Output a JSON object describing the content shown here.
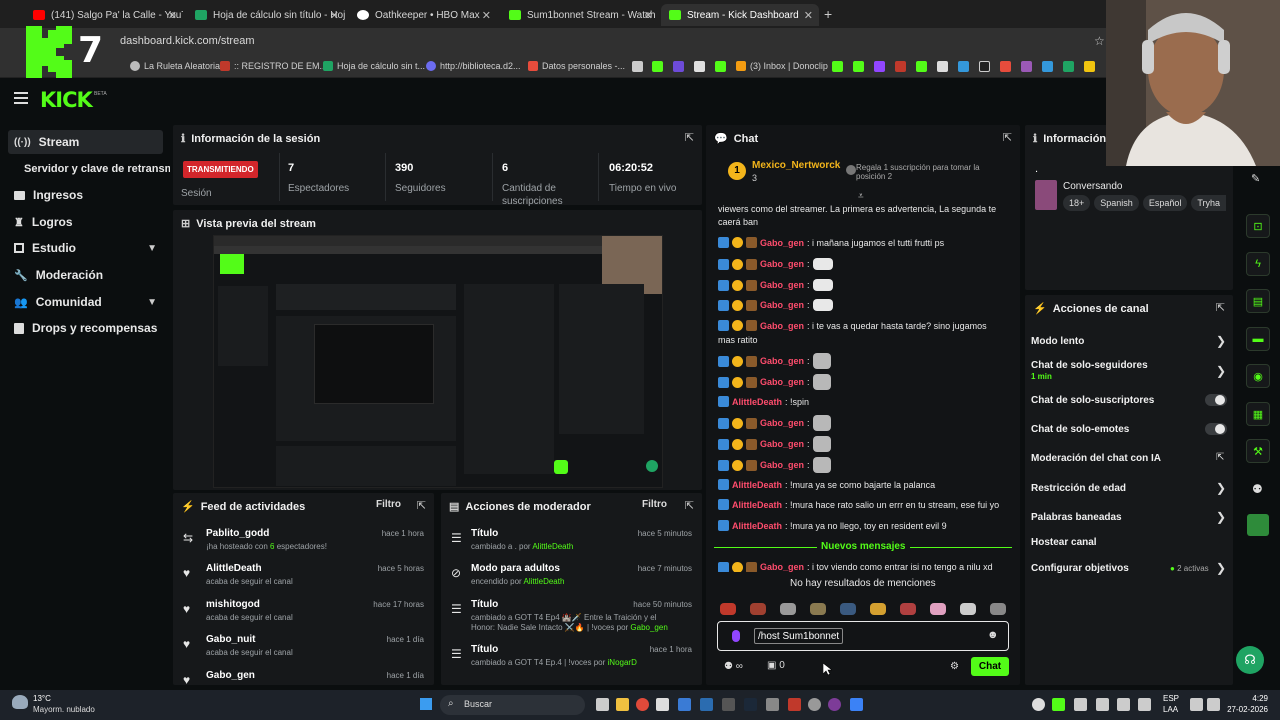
{
  "browser": {
    "tabs": [
      {
        "label": "(141) Salgo Pa' la Calle - YouTu",
        "color": "#ff0000"
      },
      {
        "label": "Hoja de cálculo sin título - Hoja",
        "color": "#1fa463"
      },
      {
        "label": "Oathkeeper • HBO Max",
        "color": "#ffffff"
      },
      {
        "label": "Sum1bonnet Stream - Watch Li",
        "color": "#53fc18"
      },
      {
        "label": "Stream - Kick Dashboard",
        "color": "#53fc18"
      }
    ],
    "new_tab": "+",
    "url": "dashboard.kick.com/stream",
    "bookmarks": [
      "La Ruleta Aleatoria",
      ":: REGISTRO DE EM...",
      "Hoja de cálculo sin t...",
      "http://biblioteca.d2...",
      "Datos personales -...",
      "(3) Inbox | Donoclip"
    ]
  },
  "logo": {
    "overlay_text": "7",
    "app_logo": "KICK",
    "beta": "BETA"
  },
  "sidebar": {
    "items": [
      {
        "label": "Stream",
        "icon": "signal-icon"
      },
      {
        "label": "Servidor y clave de retransm",
        "icon": ""
      },
      {
        "label": "Ingresos",
        "icon": "wallet-icon"
      },
      {
        "label": "Logros",
        "icon": "trophy-icon"
      },
      {
        "label": "Estudio",
        "icon": "grid-icon"
      },
      {
        "label": "Moderación",
        "icon": "wrench-icon"
      },
      {
        "label": "Comunidad",
        "icon": "people-icon"
      },
      {
        "label": "Drops y recompensas",
        "icon": "gift-icon"
      }
    ]
  },
  "session": {
    "title": "Información de la sesión",
    "status": "TRANSMITIENDO",
    "status_label": "Sesión",
    "stats": [
      {
        "value": "7",
        "label": "Espectadores"
      },
      {
        "value": "390",
        "label": "Seguidores"
      },
      {
        "value": "6",
        "label": "Cantidad de suscripciones"
      },
      {
        "value": "06:20:52",
        "label": "Tiempo en vivo"
      }
    ]
  },
  "preview": {
    "title": "Vista previa del stream"
  },
  "feed": {
    "title": "Feed de actividades",
    "filter": "Filtro",
    "items": [
      {
        "name": "Pablito_godd",
        "sub_pre": "¡ha hosteado con ",
        "sub_hl": "6",
        "sub_post": " espectadores!",
        "time": "hace 1 hora",
        "icon": "host-icon"
      },
      {
        "name": "AlittleDeath",
        "sub_pre": "acaba de seguir el canal",
        "sub_hl": "",
        "sub_post": "",
        "time": "hace 5 horas",
        "icon": "heart-icon"
      },
      {
        "name": "mishitogod",
        "sub_pre": "acaba de seguir el canal",
        "sub_hl": "",
        "sub_post": "",
        "time": "hace 17 horas",
        "icon": "heart-icon"
      },
      {
        "name": "Gabo_nuit",
        "sub_pre": "acaba de seguir el canal",
        "sub_hl": "",
        "sub_post": "",
        "time": "hace 1 día",
        "icon": "heart-icon"
      },
      {
        "name": "Gabo_gen",
        "sub_pre": "",
        "sub_hl": "",
        "sub_post": "",
        "time": "hace 1 día",
        "icon": "heart-icon"
      }
    ]
  },
  "modactions": {
    "title": "Acciones de moderador",
    "filter": "Filtro",
    "items": [
      {
        "name": "Título",
        "sub_pre": "cambiado a . por ",
        "sub_hl": "AlittleDeath",
        "time": "hace 5 minutos",
        "icon": "list-icon"
      },
      {
        "name": "Modo para adultos",
        "sub_pre": "encendido por ",
        "sub_hl": "AlittleDeath",
        "time": "hace 7 minutos",
        "icon": "slash-icon"
      },
      {
        "name": "Título",
        "sub_pre": "cambiado a GOT T4 Ep4 🏰🗡️ Entre la Traición y el Honor: Nadie Sale Intacto ⚔️🔥 | !voces por ",
        "sub_hl": "Gabo_gen",
        "time": "hace 50 minutos",
        "icon": "list-icon"
      },
      {
        "name": "Título",
        "sub_pre": "cambiado a GOT T4 Ep.4 | !voces por ",
        "sub_hl": "iNogarD",
        "time": "hace 1 hora",
        "icon": "list-icon"
      }
    ]
  },
  "chat": {
    "title": "Chat",
    "pinned_user": "Mexico_Nertworck",
    "pinned_count": "3",
    "pinned_promo": "Regala 1 suscripción para tomar la posición 2",
    "top_text": "viewers como del streamer. La primera es advertencia, La segunda te caerá ban",
    "messages": [
      {
        "user": "Gabo_gen",
        "text": ": i mañana jugamos el tutti frutti ps",
        "emote": false
      },
      {
        "user": "Gabo_gen",
        "text": ":",
        "emote": true
      },
      {
        "user": "Gabo_gen",
        "text": ":",
        "emote": true
      },
      {
        "user": "Gabo_gen",
        "text": ":",
        "emote": true
      },
      {
        "user": "Gabo_gen",
        "text": ": i te vas a quedar hasta tarde? sino jugamos",
        "emote": false
      },
      {
        "user": "Gabo_gen",
        "text": ":",
        "emote": true
      },
      {
        "user": "Gabo_gen",
        "text": ":",
        "emote": true
      },
      {
        "user": "AlittleDeath",
        "text": ": !spin",
        "emote": false
      },
      {
        "user": "Gabo_gen",
        "text": ":",
        "emote": true
      },
      {
        "user": "Gabo_gen",
        "text": ":",
        "emote": true
      },
      {
        "user": "Gabo_gen",
        "text": ":",
        "emote": true
      },
      {
        "user": "AlittleDeath",
        "text": ": !mura ya se como bajarte la palanca",
        "emote": false
      },
      {
        "user": "AlittleDeath",
        "text": ": !mura hace rato salio un errr en tu stream, ese fui yo",
        "emote": false
      },
      {
        "user": "AlittleDeath",
        "text": ": !mura ya no llego, toy en resident evil 9",
        "emote": false
      }
    ],
    "wrap_line": "mas ratito",
    "new_messages": "Nuevos mensajes",
    "last_msg_user": "Gabo_gen",
    "last_msg_text": ": i tov viendo como entrar isi no tengo a nilu xd",
    "no_mentions": "No hay resultados de menciones",
    "input_value": "/host Sum1bonnet",
    "viewers_icon_text": "∞",
    "points": "0",
    "send": "Chat"
  },
  "channel_info": {
    "title": "Información d",
    "dot": ".",
    "category": "Conversando",
    "tags": [
      "18+",
      "Spanish",
      "Español",
      "Tryha"
    ]
  },
  "channel_actions": {
    "title": "Acciones de canal",
    "rows": [
      {
        "label": "Modo lento",
        "sub": "",
        "control": "chevron"
      },
      {
        "label": "Chat de solo-seguidores",
        "sub": "1 min",
        "control": "chevron"
      },
      {
        "label": "Chat de solo-suscriptores",
        "sub": "",
        "control": "toggle"
      },
      {
        "label": "Chat de solo-emotes",
        "sub": "",
        "control": "toggle"
      },
      {
        "label": "Moderación del chat con IA",
        "sub": "",
        "control": "external"
      },
      {
        "label": "Restricción de edad",
        "sub": "",
        "control": "chevron"
      },
      {
        "label": "Palabras baneadas",
        "sub": "",
        "control": "chevron"
      },
      {
        "label": "Hostear canal",
        "sub": "",
        "control": "none"
      },
      {
        "label": "Configurar objetivos",
        "sub": "",
        "control": "chevron"
      }
    ],
    "objectives_status": "2 activas"
  },
  "taskbar": {
    "weather_temp": "13°C",
    "weather_desc": "Mayorm. nublado",
    "search": "Buscar",
    "lang": "ESP",
    "lang2": "LAA",
    "time": "4:29",
    "date": "27-02-2026"
  },
  "colors": {
    "accent": "#53fc18",
    "live": "#d3262b",
    "chat_user": "#ff4d6d"
  }
}
